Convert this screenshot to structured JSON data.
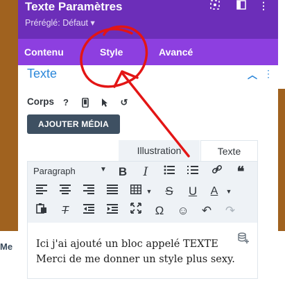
{
  "modal": {
    "title": "Texte Paramètres",
    "preset": "Préréglé: Défaut ▾",
    "tabs": [
      "Contenu",
      "Style",
      "Avancé"
    ]
  },
  "section": {
    "title": "Texte",
    "corps_label": "Corps",
    "corps_help": "?",
    "add_media": "AJOUTER MÉDIA"
  },
  "editor": {
    "tabs": [
      "Illustration",
      "Texte"
    ],
    "format": "Paragraph",
    "text_lines": [
      "Ici j'ai ajouté un bloc appelé TEXTE",
      "Merci de me donner un style plus sexy."
    ]
  },
  "background": {
    "left_fragment": "Me"
  },
  "colors": {
    "header": "#6c2eb9",
    "tab_bar": "#8d3fe0",
    "accent_blue": "#2b87da",
    "button": "#3e5062",
    "annotation_red": "#e31515"
  }
}
